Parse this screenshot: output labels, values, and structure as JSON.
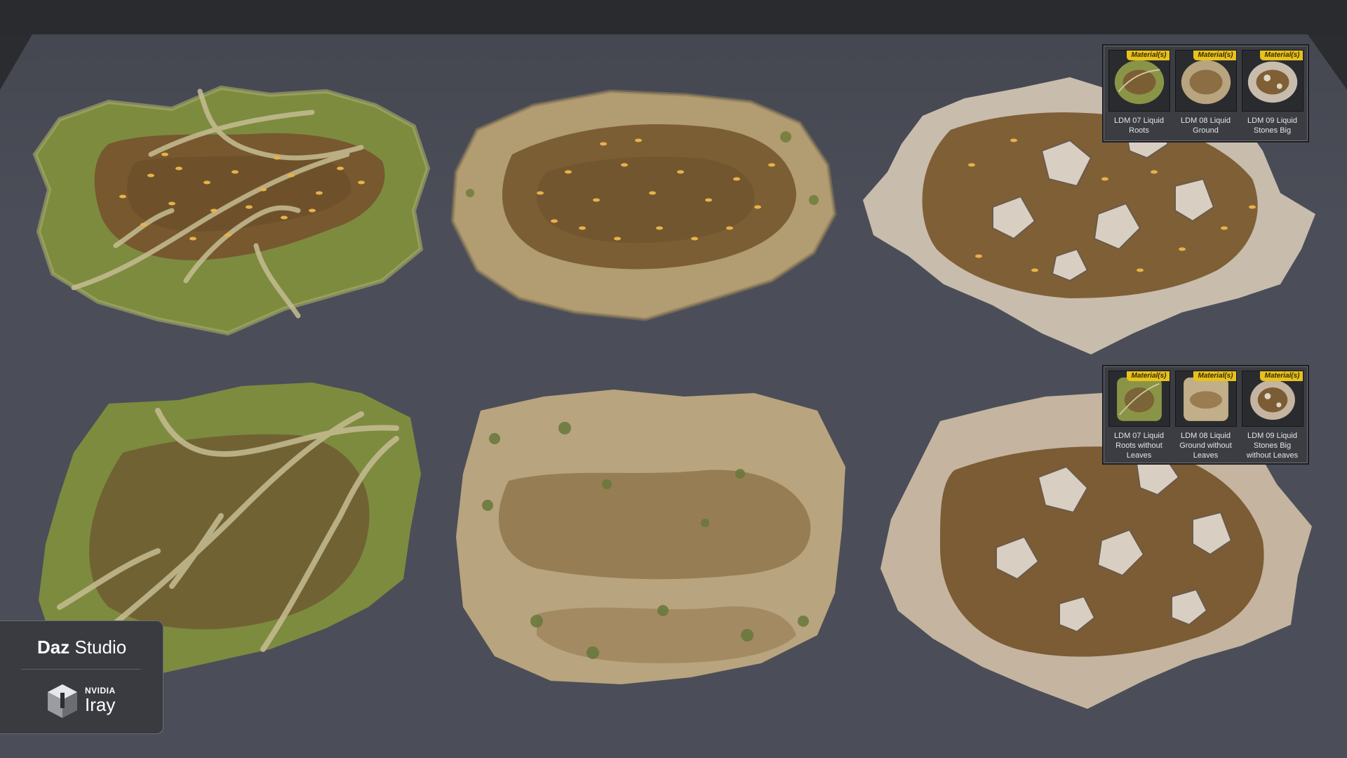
{
  "viewport": {
    "background": "#4b4e58",
    "grass_color": "#7d8b3f",
    "mud_color": "#7a5a30",
    "gravel_color": "#b29c72",
    "stone_color": "#c8bcad",
    "leaf_color": "#e8b24a"
  },
  "materials_top": {
    "items": [
      {
        "badge": "Material(s)",
        "label": "LDM 07 Liquid Roots",
        "icon": "grass-roots-thumbnail"
      },
      {
        "badge": "Material(s)",
        "label": "LDM 08 Liquid Ground",
        "icon": "gravel-ground-thumbnail"
      },
      {
        "badge": "Material(s)",
        "label": "LDM 09 Liquid Stones Big",
        "icon": "stones-thumbnail"
      }
    ]
  },
  "materials_bottom": {
    "items": [
      {
        "badge": "Material(s)",
        "label": "LDM 07 Liquid Roots without Leaves",
        "icon": "grass-roots-thumbnail"
      },
      {
        "badge": "Material(s)",
        "label": "LDM 08 Liquid Ground without Leaves",
        "icon": "gravel-ground-thumbnail"
      },
      {
        "badge": "Material(s)",
        "label": "LDM 09 Liquid Stones Big without Leaves",
        "icon": "stones-thumbnail"
      }
    ]
  },
  "brand": {
    "daz_bold": "Daz",
    "daz_rest": " Studio",
    "nvidia": "NVIDIA",
    "iray": "Iray",
    "icon": "iray-cube-icon"
  }
}
